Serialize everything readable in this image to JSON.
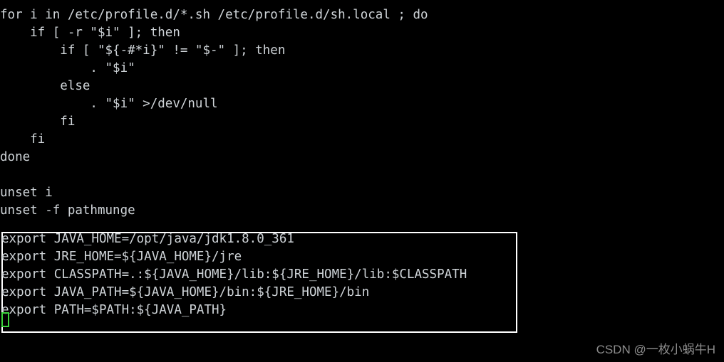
{
  "terminal": {
    "background_color": "#000000",
    "foreground_color": "#cfd4d8",
    "box_border_color": "#ffffff",
    "cursor_color": "#3cd23c"
  },
  "script_lines": [
    "for i in /etc/profile.d/*.sh /etc/profile.d/sh.local ; do",
    "    if [ -r \"$i\" ]; then",
    "        if [ \"${-#*i}\" != \"$-\" ]; then",
    "            . \"$i\"",
    "        else",
    "            . \"$i\" >/dev/null",
    "        fi",
    "    fi",
    "done",
    "",
    "unset i",
    "unset -f pathmunge"
  ],
  "export_block": {
    "lines": [
      "export JAVA_HOME=/opt/java/jdk1.8.0_361",
      "export JRE_HOME=${JAVA_HOME}/jre",
      "export CLASSPATH=.:${JAVA_HOME}/lib:${JRE_HOME}/lib:$CLASSPATH",
      "export JAVA_PATH=${JAVA_HOME}/bin:${JRE_HOME}/bin",
      "export PATH=$PATH:${JAVA_PATH}"
    ]
  },
  "cursor": {
    "label": "block-cursor"
  },
  "watermark": {
    "text": "CSDN @一枚小蜗牛H"
  }
}
